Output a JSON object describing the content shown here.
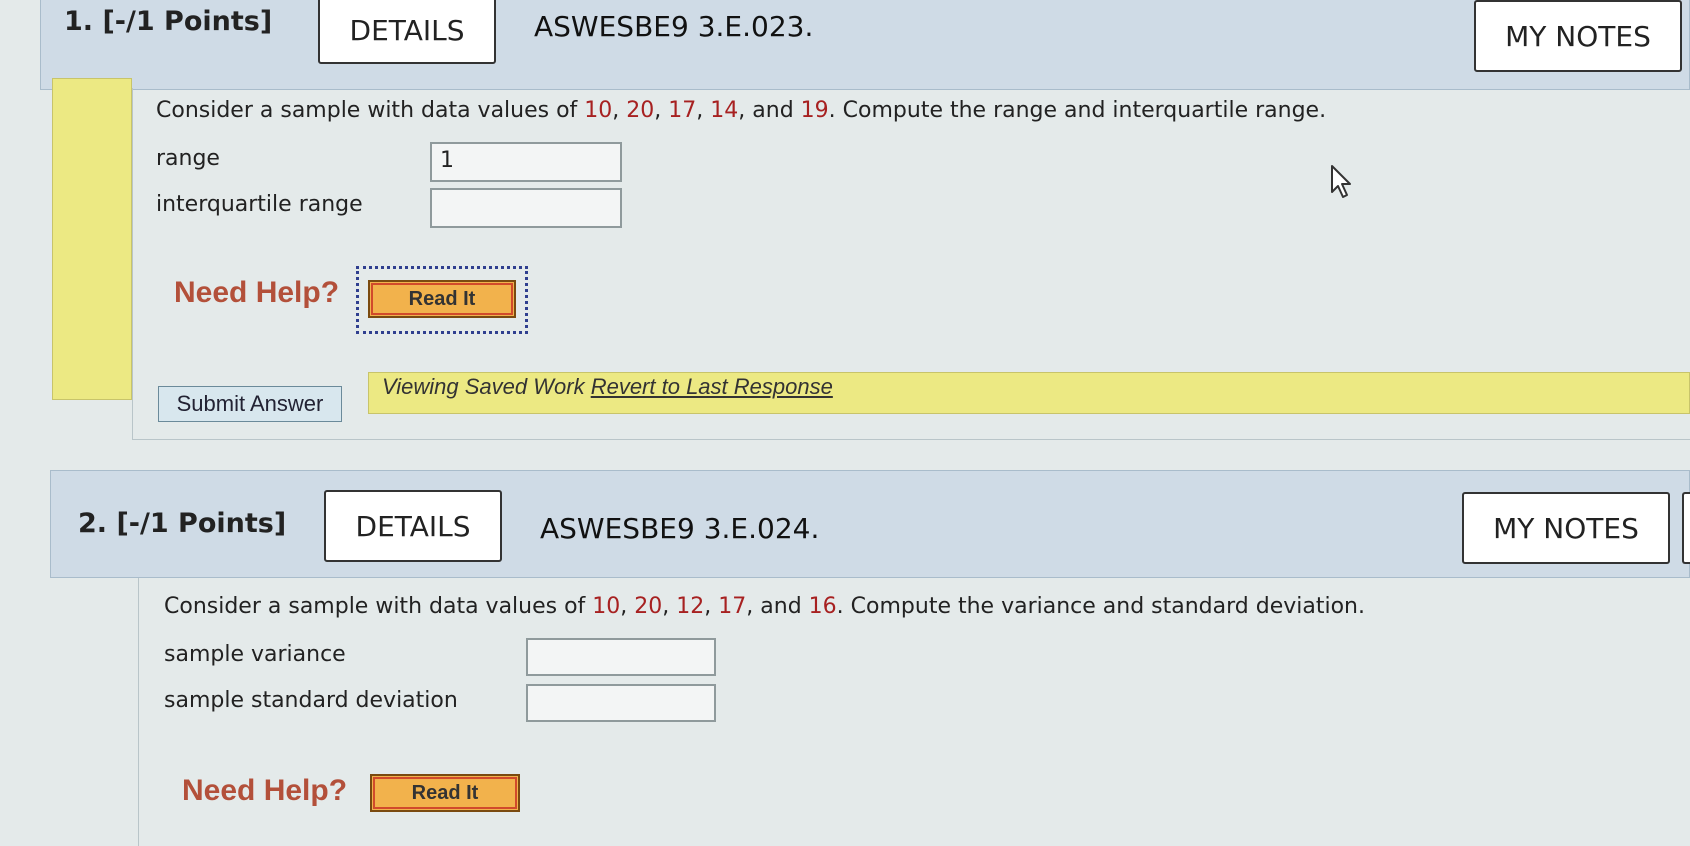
{
  "question1": {
    "label": "1.  [-/1 Points]",
    "details_label": "DETAILS",
    "code": "ASWESBE9 3.E.023.",
    "my_notes_label": "MY NOTES",
    "text_prefix": "Consider a sample with data values of ",
    "values": [
      "10",
      "20",
      "17",
      "14",
      "19"
    ],
    "text_suffix": ". Compute the range and interquartile range.",
    "fields": [
      {
        "label": "range",
        "value": "1"
      },
      {
        "label": "interquartile range",
        "value": ""
      }
    ],
    "need_help": "Need Help?",
    "read_it": "Read It",
    "submit_label": "Submit Answer",
    "saved_text": "Viewing Saved Work ",
    "revert_link": "Revert to Last Response"
  },
  "question2": {
    "label": "2.  [-/1 Points]",
    "details_label": "DETAILS",
    "code": "ASWESBE9 3.E.024.",
    "my_notes_label": "MY NOTES",
    "text_prefix": "Consider a sample with data values of ",
    "values": [
      "10",
      "20",
      "12",
      "17",
      "16"
    ],
    "text_suffix": ". Compute the variance and standard deviation.",
    "fields": [
      {
        "label": "sample variance",
        "value": ""
      },
      {
        "label": "sample standard deviation",
        "value": ""
      }
    ],
    "need_help": "Need Help?",
    "read_it": "Read It"
  },
  "colors": {
    "number_highlight": "#a72121",
    "need_help": "#b3503a",
    "read_it_button": "#f2b24c",
    "saved_bar": "#ece983",
    "header_band": "#cfdbe6"
  },
  "icons": {
    "cursor": "mouse-pointer-icon"
  }
}
